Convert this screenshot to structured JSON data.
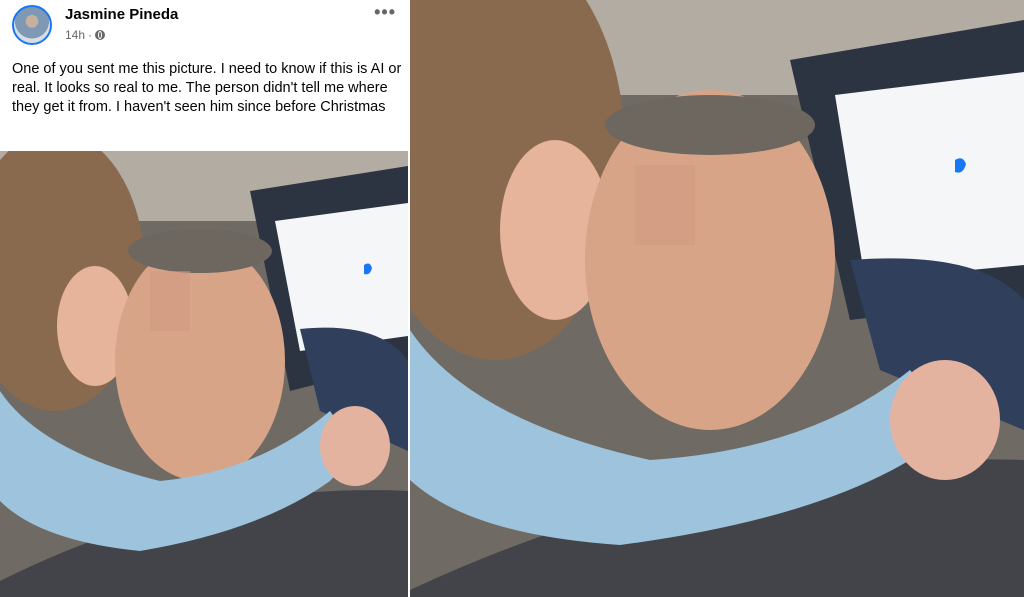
{
  "post": {
    "author": "Jasmine Pineda",
    "time": "14h",
    "separator": "·",
    "privacy_icon": "globe-icon",
    "more_icon": "more-options-icon",
    "more_label": "•••",
    "text": "One of you sent me this picture. I need to know if this is AI or real. It looks so real to me. The person didn't tell me where they get it from. I haven't seen him since before Christmas"
  },
  "photos": [
    {
      "name": "post-photo",
      "alt": "couple-selfie-in-car"
    },
    {
      "name": "enlarged-photo",
      "alt": "couple-selfie-in-car-enlarged"
    }
  ],
  "colors": {
    "accent": "#1877f2",
    "text": "#050505",
    "secondary": "#65676b",
    "sweater": "#9ec3dc",
    "window": "#f4f6f8"
  }
}
